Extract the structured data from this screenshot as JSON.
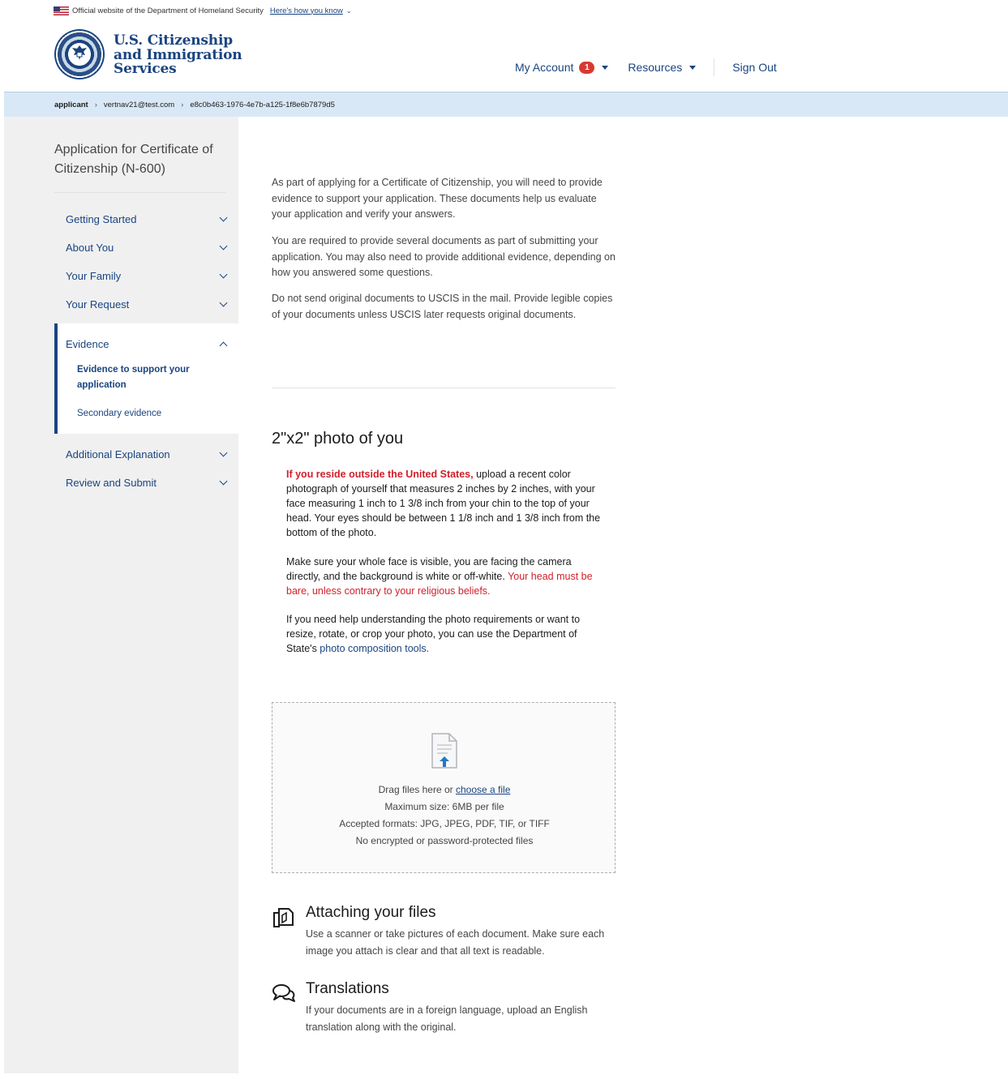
{
  "gov_banner": {
    "official_text": "Official website of the Department of Homeland Security",
    "know_link": "Here's how you know"
  },
  "header": {
    "agency_line1": "U.S. Citizenship",
    "agency_line2": "and Immigration",
    "agency_line3": "Services",
    "my_account": "My Account",
    "account_badge": "1",
    "resources": "Resources",
    "sign_out": "Sign Out"
  },
  "breadcrumb": {
    "items": [
      "applicant",
      "vertnav21@test.com",
      "e8c0b463-1976-4e7b-a125-1f8e6b7879d5"
    ]
  },
  "sidebar": {
    "title": "Application for Certificate of Citizenship (N-600)",
    "items": [
      {
        "label": "Getting Started"
      },
      {
        "label": "About You"
      },
      {
        "label": "Your Family"
      },
      {
        "label": "Your Request"
      },
      {
        "label": "Evidence"
      },
      {
        "label": "Additional Explanation"
      },
      {
        "label": "Review and Submit"
      }
    ],
    "evidence_sub": {
      "active_line1": "Evidence to support your",
      "active_line2": "application",
      "secondary": "Secondary evidence"
    }
  },
  "intro": {
    "p1": "As part of applying for a Certificate of Citizenship, you will need to provide evidence to support your application. These documents help us evaluate your application and verify your answers.",
    "p2": "You are required to provide several documents as part of submitting your application. You may also need to provide additional evidence, depending on how you answered some questions.",
    "p3": "Do not send original documents to USCIS in the mail. Provide legible copies of your documents unless USCIS later requests original documents."
  },
  "photo_section": {
    "heading": "2\"x2\" photo of you",
    "q1_red": "If you reside outside the United States,",
    "q1_rest": " upload a recent color photograph of yourself that measures 2 inches by 2 inches, with your face measuring 1 inch to 1 3/8 inch from your chin to the top of your head. Your eyes should be between 1 1/8 inch and 1 3/8 inch from the bottom of the photo.",
    "q2_start": "Make sure your whole face is visible, you are facing the camera directly, and the background is white or off-white. ",
    "q2_red": "Your head must be bare, unless contrary to your religious beliefs.",
    "q3_start": "If you need help understanding the photo requirements or want to resize, rotate, or crop your photo, you can use the Department of State's ",
    "q3_link": "photo composition tools."
  },
  "upload": {
    "drag_text": "Drag files here or ",
    "choose_link": "choose a file",
    "max_size": "Maximum size: 6MB per file",
    "formats": "Accepted formats: JPG, JPEG, PDF, TIF, or TIFF",
    "no_encrypted": "No encrypted or password-protected files"
  },
  "attaching": {
    "heading": "Attaching your files",
    "text": "Use a scanner or take pictures of each document. Make sure each image you attach is clear and that all text is readable."
  },
  "translations": {
    "heading": "Translations",
    "text": "If your documents are in a foreign language, upload an English translation along with the original."
  },
  "colors": {
    "primary": "#1a4480",
    "alert": "#d11f2a",
    "breadcrumb_bg": "#d9e8f6",
    "sidebar_bg": "#f0f0f0"
  },
  "icons": [
    "us-flag-icon",
    "dhs-seal-icon",
    "caret-down-icon",
    "chevron-down-icon",
    "chevron-up-icon",
    "file-upload-icon",
    "copy-files-icon",
    "speech-bubbles-icon"
  ]
}
